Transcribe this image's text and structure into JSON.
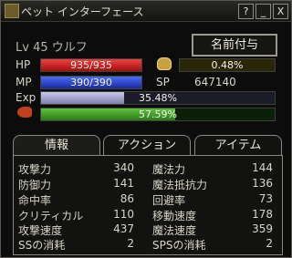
{
  "window": {
    "title": "ペット インターフェース"
  },
  "titlebar": {
    "help": "?",
    "minimize": "_",
    "close": "X"
  },
  "pet": {
    "level_line": "Lv 45 ウルフ",
    "name_button": "名前付与"
  },
  "bars": {
    "hp_label": "HP",
    "hp_value": "935/935",
    "hp_fill": 1.0,
    "mp_label": "MP",
    "mp_value": "390/390",
    "mp_fill": 1.0,
    "gold_value": "0.48%",
    "gold_fill": 0.0048,
    "sp_label": "SP",
    "sp_value": "647140",
    "exp_label": "Exp",
    "exp_value": "35.48%",
    "exp_fill": 0.3548,
    "sat_value": "57.59%",
    "sat_fill": 0.5759
  },
  "tabs": [
    "情報",
    "アクション",
    "アイテム"
  ],
  "stats_left": [
    {
      "label": "攻撃力",
      "value": "340"
    },
    {
      "label": "防御力",
      "value": "141"
    },
    {
      "label": "命中率",
      "value": "86"
    },
    {
      "label": "クリティカル",
      "value": "110"
    },
    {
      "label": "攻撃速度",
      "value": "437"
    },
    {
      "label": "SSの消耗",
      "value": "2"
    }
  ],
  "stats_right": [
    {
      "label": "魔法力",
      "value": "144"
    },
    {
      "label": "魔法抵抗力",
      "value": "136"
    },
    {
      "label": "回避率",
      "value": "73"
    },
    {
      "label": "移動速度",
      "value": "178"
    },
    {
      "label": "魔法速度",
      "value": "359"
    },
    {
      "label": "SPSの消耗",
      "value": "2"
    }
  ],
  "colors": {
    "hp": "#d82020",
    "mp": "#2a44d0",
    "exp": "#a8a8d0",
    "sat": "#40a028"
  },
  "icons": {
    "title": "pet-icon",
    "gold": "moneybag-icon",
    "sat": "fish-icon"
  }
}
